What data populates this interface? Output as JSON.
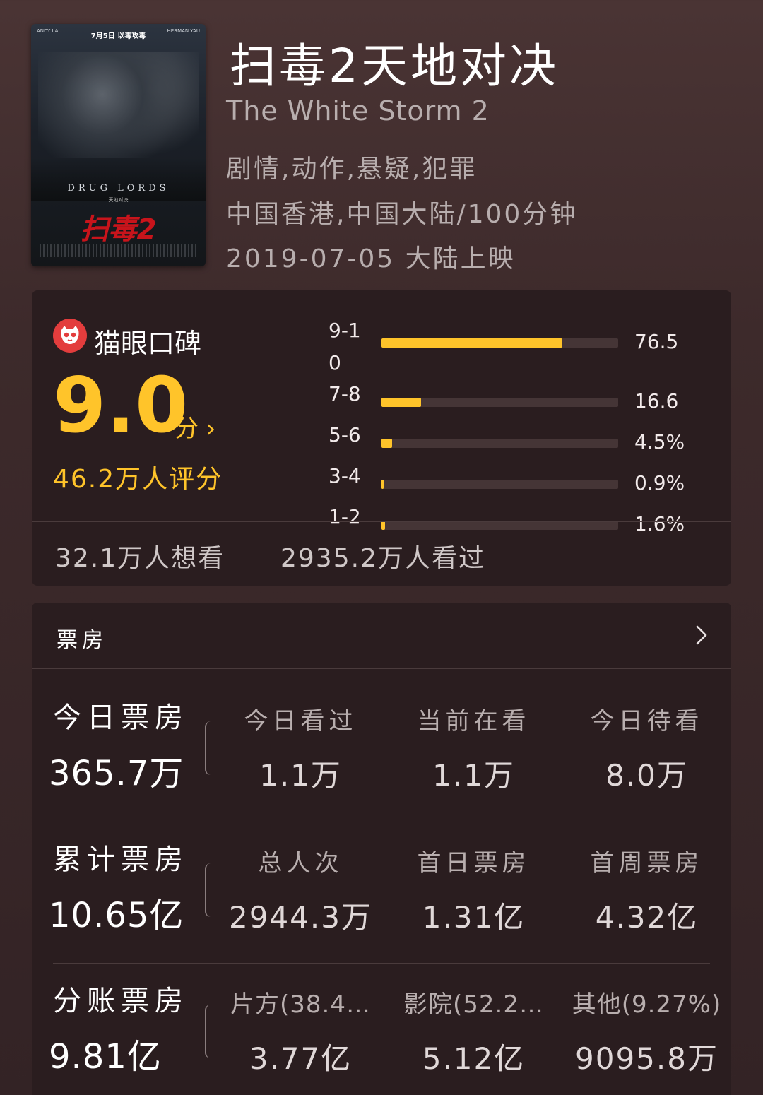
{
  "poster": {
    "left_credit": "ANDY LAU",
    "right_credit": "HERMAN YAU",
    "date_tag": "7月5日 以毒攻毒",
    "drug_lords": "DRUG LORDS",
    "sub": "天地对决",
    "logo_text": "扫毒2"
  },
  "movie": {
    "title": "扫毒2天地对决",
    "english_title": "The White Storm 2",
    "genres": "剧情,动作,悬疑,犯罪",
    "region_duration": "中国香港,中国大陆/100分钟",
    "release": "2019-07-05 大陆上映"
  },
  "rating": {
    "source_label": "猫眼口碑",
    "score": "9.0",
    "score_unit": "分 ›",
    "raters": "46.2万人评分",
    "distribution": [
      {
        "label": "9-10",
        "percent_text": "76.5",
        "value": 76.5
      },
      {
        "label": "7-8",
        "percent_text": "16.6",
        "value": 16.6
      },
      {
        "label": "5-6",
        "percent_text": "4.5%",
        "value": 4.5
      },
      {
        "label": "3-4",
        "percent_text": "0.9%",
        "value": 0.9
      },
      {
        "label": "1-2",
        "percent_text": "1.6%",
        "value": 1.6
      }
    ],
    "want_to_see": "32.1万人想看",
    "have_seen": "2935.2万人看过"
  },
  "box_office": {
    "title": "票房",
    "rows": [
      {
        "label": "今日票房",
        "value": "365.7万",
        "cols": [
          {
            "label": "今日看过",
            "value": "1.1万"
          },
          {
            "label": "当前在看",
            "value": "1.1万"
          },
          {
            "label": "今日待看",
            "value": "8.0万"
          }
        ]
      },
      {
        "label": "累计票房",
        "value": "10.65亿",
        "cols": [
          {
            "label": "总人次",
            "value": "2944.3万"
          },
          {
            "label": "首日票房",
            "value": "1.31亿"
          },
          {
            "label": "首周票房",
            "value": "4.32亿"
          }
        ]
      },
      {
        "label": "分账票房",
        "value": "9.81亿",
        "cols": [
          {
            "label": "片方(38.4…",
            "value": "3.77亿"
          },
          {
            "label": "影院(52.2…",
            "value": "5.12亿"
          },
          {
            "label": "其他(9.27%)",
            "value": "9095.8万"
          }
        ]
      }
    ]
  },
  "colors": {
    "accent": "#ffc42a",
    "maoyan_red": "#e33d3d",
    "card_bg": "#2a1d1f"
  }
}
